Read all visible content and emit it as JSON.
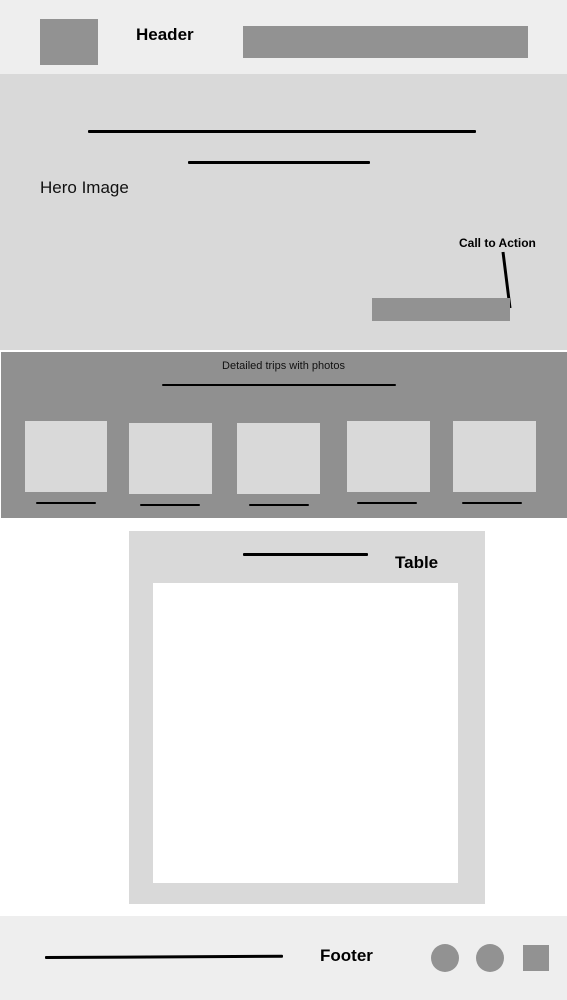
{
  "header": {
    "title": "Header"
  },
  "hero": {
    "label": "Hero Image",
    "cta_label": "Call to Action"
  },
  "trips": {
    "title": "Detailed trips with photos"
  },
  "table": {
    "label": "Table"
  },
  "footer": {
    "label": "Footer"
  }
}
